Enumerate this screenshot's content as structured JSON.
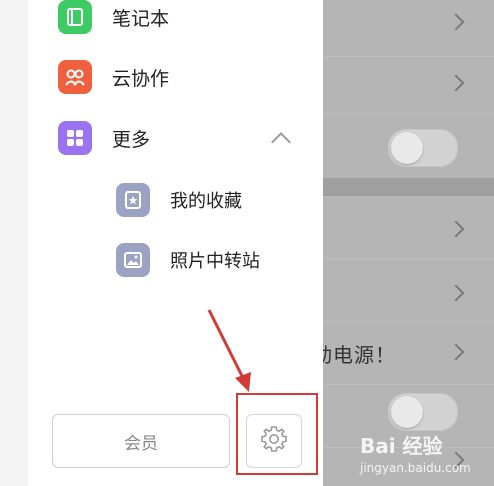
{
  "drawer": {
    "items": [
      {
        "label": "笔记本",
        "icon": "notebook-icon",
        "color": "#3ecb63"
      },
      {
        "label": "云协作",
        "icon": "collaboration-icon",
        "color": "#f0603e"
      },
      {
        "label": "更多",
        "icon": "grid-icon",
        "color": "#9b73f0"
      }
    ],
    "more_subitems": [
      {
        "label": "我的收藏",
        "icon": "favorites-icon"
      },
      {
        "label": "照片中转站",
        "icon": "photo-icon"
      }
    ],
    "member_button": "会员",
    "settings_icon": "gear-icon"
  },
  "background": {
    "visible_text": "动电源！"
  },
  "annotation": {
    "highlight_color": "#d23a3a",
    "arrow_color": "#d23a3a"
  },
  "watermark": {
    "main": "Bai  经验",
    "sub": "jingyan.baidu.com"
  }
}
